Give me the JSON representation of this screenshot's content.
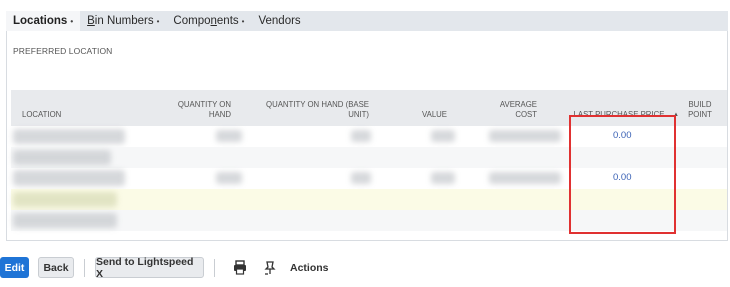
{
  "tabs": [
    {
      "label": "Locations",
      "active": true
    },
    {
      "label": "Bin Numbers",
      "active": false
    },
    {
      "label": "Components",
      "active": false
    },
    {
      "label": "Vendors",
      "active": false
    }
  ],
  "tab_separator": "•",
  "section": {
    "title": "PREFERRED LOCATION"
  },
  "table": {
    "columns": {
      "location": "LOCATION",
      "qty_on_hand": "QUANTITY ON HAND",
      "qty_on_hand_base": "QUANTITY ON HAND (BASE UNIT)",
      "value": "VALUE",
      "average_cost": "AVERAGE COST",
      "last_purchase_price": "LAST PURCHASE PRICE",
      "build_point": "BUILD POINT",
      "build_point_sort": "▲"
    },
    "rows": [
      {
        "last_purchase_price": "0.00"
      },
      {
        "last_purchase_price": ""
      },
      {
        "last_purchase_price": "0.00"
      }
    ]
  },
  "toolbar": {
    "edit_label": "Edit",
    "back_label": "Back",
    "send_label": "Send to Lightspeed X",
    "actions_label": "Actions",
    "print_icon": "print-icon",
    "pin_icon": "pin-icon"
  },
  "colors": {
    "primary_button": "#1f74d6",
    "highlight_box": "#e03131",
    "link": "#3b62b5",
    "highlight_row": "#fbfbe6"
  }
}
